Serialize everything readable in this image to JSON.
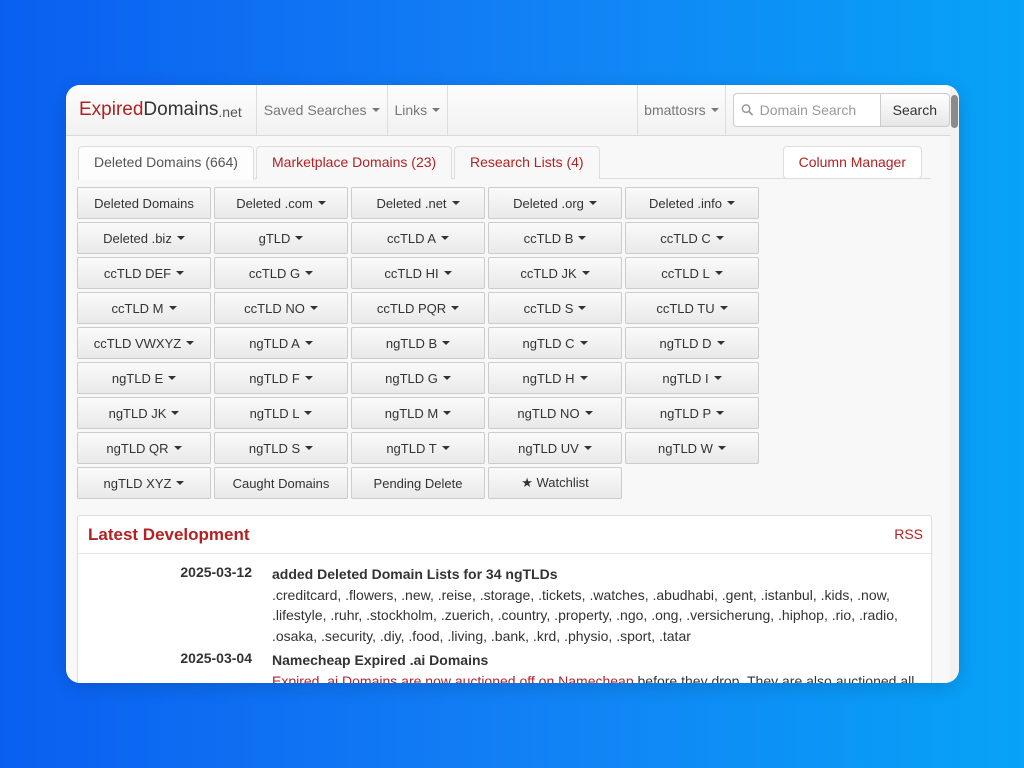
{
  "brand": {
    "part1": "Expired",
    "part2": "Domains",
    "part3": ".net"
  },
  "nav": {
    "saved_searches": "Saved Searches",
    "links": "Links",
    "user": "bmattosrs",
    "search_placeholder": "Domain Search",
    "search_button": "Search"
  },
  "tabs": [
    {
      "label": "Deleted Domains (664)"
    },
    {
      "label": "Marketplace Domains (23)"
    },
    {
      "label": "Research Lists (4)"
    }
  ],
  "column_manager": "Column Manager",
  "grid": [
    {
      "label": "Deleted Domains",
      "dropdown": false
    },
    {
      "label": "Deleted .com",
      "dropdown": true
    },
    {
      "label": "Deleted .net",
      "dropdown": true
    },
    {
      "label": "Deleted .org",
      "dropdown": true
    },
    {
      "label": "Deleted .info",
      "dropdown": true
    },
    {
      "label": "Deleted .biz",
      "dropdown": true
    },
    {
      "label": "gTLD",
      "dropdown": true
    },
    {
      "label": "ccTLD A",
      "dropdown": true
    },
    {
      "label": "ccTLD B",
      "dropdown": true
    },
    {
      "label": "ccTLD C",
      "dropdown": true
    },
    {
      "label": "ccTLD DEF",
      "dropdown": true
    },
    {
      "label": "ccTLD G",
      "dropdown": true
    },
    {
      "label": "ccTLD HI",
      "dropdown": true
    },
    {
      "label": "ccTLD JK",
      "dropdown": true
    },
    {
      "label": "ccTLD L",
      "dropdown": true
    },
    {
      "label": "ccTLD M",
      "dropdown": true
    },
    {
      "label": "ccTLD NO",
      "dropdown": true
    },
    {
      "label": "ccTLD PQR",
      "dropdown": true
    },
    {
      "label": "ccTLD S",
      "dropdown": true
    },
    {
      "label": "ccTLD TU",
      "dropdown": true
    },
    {
      "label": "ccTLD VWXYZ",
      "dropdown": true
    },
    {
      "label": "ngTLD A",
      "dropdown": true
    },
    {
      "label": "ngTLD B",
      "dropdown": true
    },
    {
      "label": "ngTLD C",
      "dropdown": true
    },
    {
      "label": "ngTLD D",
      "dropdown": true
    },
    {
      "label": "ngTLD E",
      "dropdown": true
    },
    {
      "label": "ngTLD F",
      "dropdown": true
    },
    {
      "label": "ngTLD G",
      "dropdown": true
    },
    {
      "label": "ngTLD H",
      "dropdown": true
    },
    {
      "label": "ngTLD I",
      "dropdown": true
    },
    {
      "label": "ngTLD JK",
      "dropdown": true
    },
    {
      "label": "ngTLD L",
      "dropdown": true
    },
    {
      "label": "ngTLD M",
      "dropdown": true
    },
    {
      "label": "ngTLD NO",
      "dropdown": true
    },
    {
      "label": "ngTLD P",
      "dropdown": true
    },
    {
      "label": "ngTLD QR",
      "dropdown": true
    },
    {
      "label": "ngTLD S",
      "dropdown": true
    },
    {
      "label": "ngTLD T",
      "dropdown": true
    },
    {
      "label": "ngTLD UV",
      "dropdown": true
    },
    {
      "label": "ngTLD W",
      "dropdown": true
    },
    {
      "label": "ngTLD XYZ",
      "dropdown": true
    },
    {
      "label": "Caught Domains",
      "dropdown": false
    },
    {
      "label": "Pending Delete",
      "dropdown": false
    },
    {
      "label": "★ Watchlist",
      "dropdown": false
    }
  ],
  "latest": {
    "title": "Latest Development",
    "rss": "RSS",
    "entries": [
      {
        "date": "2025-03-12",
        "headline": "added Deleted Domain Lists for 34 ngTLDs",
        "text": ".creditcard, .flowers, .new, .reise, .storage, .tickets, .watches, .abudhabi, .gent, .istanbul, .kids, .now, .lifestyle, .ruhr, .stockholm, .zuerich, .country, .property, .ngo, .ong, .versicherung, .hiphop, .rio, .radio, .osaka, .security, .diy, .food, .living, .bank, .krd, .physio, .sport, .tatar"
      },
      {
        "date": "2025-03-04",
        "headline": "Namecheap Expired .ai Domains",
        "link_text": "Expired .ai Domains are now auctioned off on Namecheap",
        "text": " before they drop. They are also auctioned all"
      }
    ]
  },
  "colors": {
    "accent_red": "#b22222",
    "background_blue": "#1280f5"
  }
}
